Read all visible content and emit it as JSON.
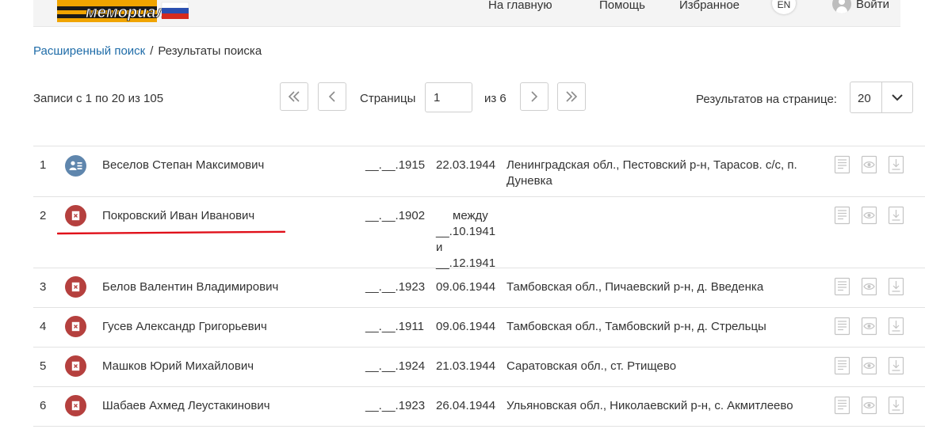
{
  "header": {
    "logo_text": "мемориал",
    "nav": [
      "На главную",
      "Помощь",
      "Избранное"
    ],
    "lang": "EN",
    "login": "Войти"
  },
  "breadcrumb": {
    "link": "Расширенный поиск",
    "separator": "/",
    "current": "Результаты поиска"
  },
  "pager": {
    "records": "Записи с 1 по 20 из 105",
    "pages_label": "Страницы",
    "page_value": "1",
    "of_pages": "из 6",
    "per_page_label": "Результатов на странице:",
    "per_page_value": "20"
  },
  "rows": [
    {
      "num": "1",
      "status": "info-icon",
      "name": "Веселов Степан Максимович",
      "born": "__.__.1915",
      "died": "22.03.1944",
      "place": "Ленинградская обл., Пестовский р-н, Тарасов. с/с, п. Дуневка"
    },
    {
      "num": "2",
      "status": "killed-icon",
      "name": "Покровский Иван Иванович",
      "born": "__.__.1902",
      "died_lines": [
        "между",
        "__.10.1941 и",
        "__.12.1941"
      ],
      "place": ""
    },
    {
      "num": "3",
      "status": "killed-icon",
      "name": "Белов Валентин Владимирович",
      "born": "__.__.1923",
      "died": "09.06.1944",
      "place": "Тамбовская обл., Пичаевский р-н, д. Введенка"
    },
    {
      "num": "4",
      "status": "killed-icon",
      "name": "Гусев Александр Григорьевич",
      "born": "__.__.1911",
      "died": "09.06.1944",
      "place": "Тамбовская обл., Тамбовский р-н, д. Стрельцы"
    },
    {
      "num": "5",
      "status": "killed-icon",
      "name": "Машков Юрий Михайлович",
      "born": "__.__.1924",
      "died": "21.03.1944",
      "place": "Саратовская обл., ст. Ртищево"
    },
    {
      "num": "6",
      "status": "killed-icon",
      "name": "Шабаев Ахмед Леустакинович",
      "born": "__.__.1923",
      "died": "26.04.1944",
      "place": "Ульяновская обл., Николаевский р-н, с. Акмитлеево"
    }
  ],
  "colors": {
    "link": "#1f6ca8",
    "status_info": "#5f86ad",
    "status_killed": "#b5403e",
    "annotation": "#e0101a"
  }
}
